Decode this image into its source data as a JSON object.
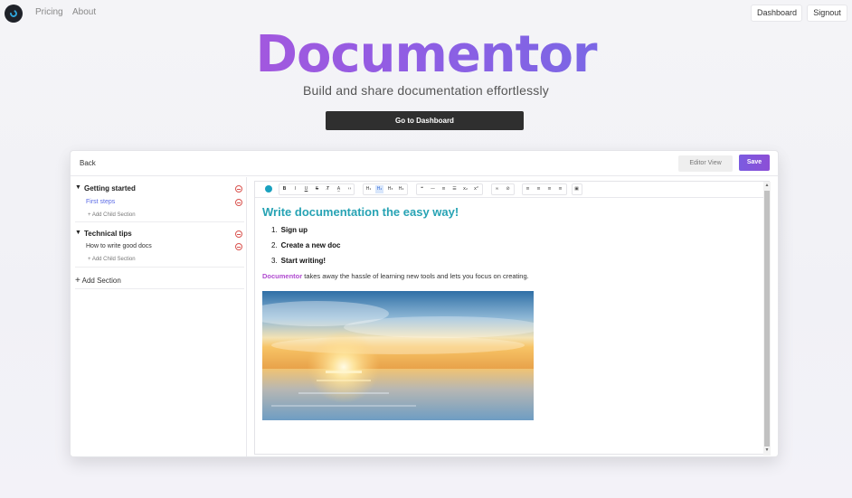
{
  "nav": {
    "links": [
      "Pricing",
      "About"
    ],
    "dashboard_label": "Dashboard",
    "signout_label": "Signout"
  },
  "hero": {
    "title": "Documentor",
    "subtitle": "Build and share documentation effortlessly",
    "cta_label": "Go to Dashboard"
  },
  "editor_card": {
    "back_label": "Back",
    "editor_view_label": "Editor View",
    "save_label": "Save"
  },
  "sidebar": {
    "sections": [
      {
        "title": "Getting started",
        "children": [
          "First steps"
        ],
        "add_child_label": "Add Child Section"
      },
      {
        "title": "Technical tips",
        "children": [
          "How to write good docs"
        ],
        "add_child_label": "Add Child Section"
      }
    ],
    "add_section_label": "Add Section"
  },
  "document": {
    "heading": "Write documentation the easy way!",
    "steps": [
      "Sign up",
      "Create a new doc",
      "Start writing!"
    ],
    "paragraph_brand": "Documentor",
    "paragraph_rest": " takes away the hassle of learning new tools and lets you focus on creating."
  },
  "colors": {
    "title_gradient_start": "#c04fd6",
    "title_gradient_end": "#5f74e6",
    "heading": "#27a3b4",
    "save_button": "#7b5be0",
    "active_child": "#5b6be6",
    "remove_icon": "#d9534f"
  }
}
